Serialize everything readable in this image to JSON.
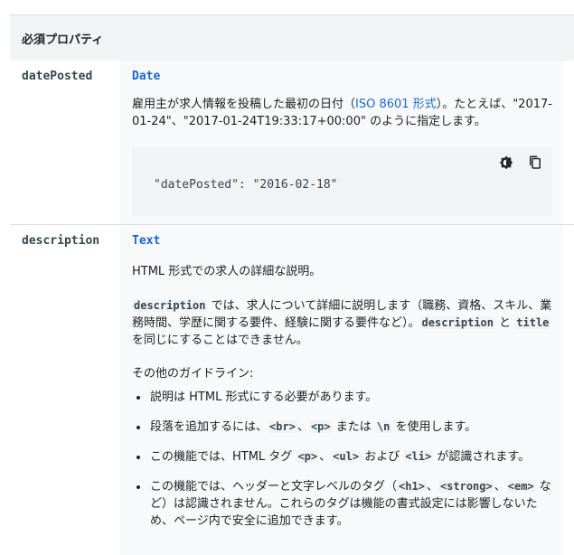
{
  "table": {
    "header_label": "必須プロパティ"
  },
  "rows": [
    {
      "name": "datePosted",
      "type": "Date",
      "description_pre": "雇用主が求人情報を投稿した最初の日付（",
      "description_link": "ISO 8601 形式",
      "description_post": "）。たとえば、\"2017-01-24\"、\"2017-01-24T19:33:17+00:00\" のように指定します。",
      "code_key": "\"datePosted\"",
      "code_sep": ": ",
      "code_value": "\"2016-02-18\"",
      "code_icons": [
        "theme-toggle-icon",
        "copy-icon"
      ]
    },
    {
      "name": "description",
      "type": "Text",
      "summary": "HTML 形式での求人の詳細な説明。",
      "detail": {
        "code1": "description",
        "text1": " では、求人について詳細に説明します（職務、資格、スキル、業務時間、学歴に関する要件、経験に関する要件など）。",
        "code2": "description",
        "text2": " と ",
        "code3": "title",
        "text3": " を同じにすることはできません。"
      },
      "guidelines_heading": "その他のガイドライン:",
      "bullets": {
        "b1": "説明は HTML 形式にする必要があります。",
        "b2_pre": "段落を追加するには、",
        "b2_c1": "<br>",
        "b2_s1": "、",
        "b2_c2": "<p>",
        "b2_s2": " または ",
        "b2_c3": "\\n",
        "b2_post": " を使用します。",
        "b3_pre": "この機能では、HTML タグ ",
        "b3_c1": "<p>",
        "b3_s1": "、",
        "b3_c2": "<ul>",
        "b3_s2": " および ",
        "b3_c3": "<li>",
        "b3_post": " が認識されます。",
        "b4_pre": "この機能では、ヘッダーと文字レベルのタグ（",
        "b4_c1": "<h1>",
        "b4_s1": "、",
        "b4_c2": "<strong>",
        "b4_s2": "、",
        "b4_c3": "<em>",
        "b4_post": " など）は認識されません。これらのタグは機能の書式設定には影響しないため、ページ内で安全に追加できます。"
      }
    }
  ]
}
